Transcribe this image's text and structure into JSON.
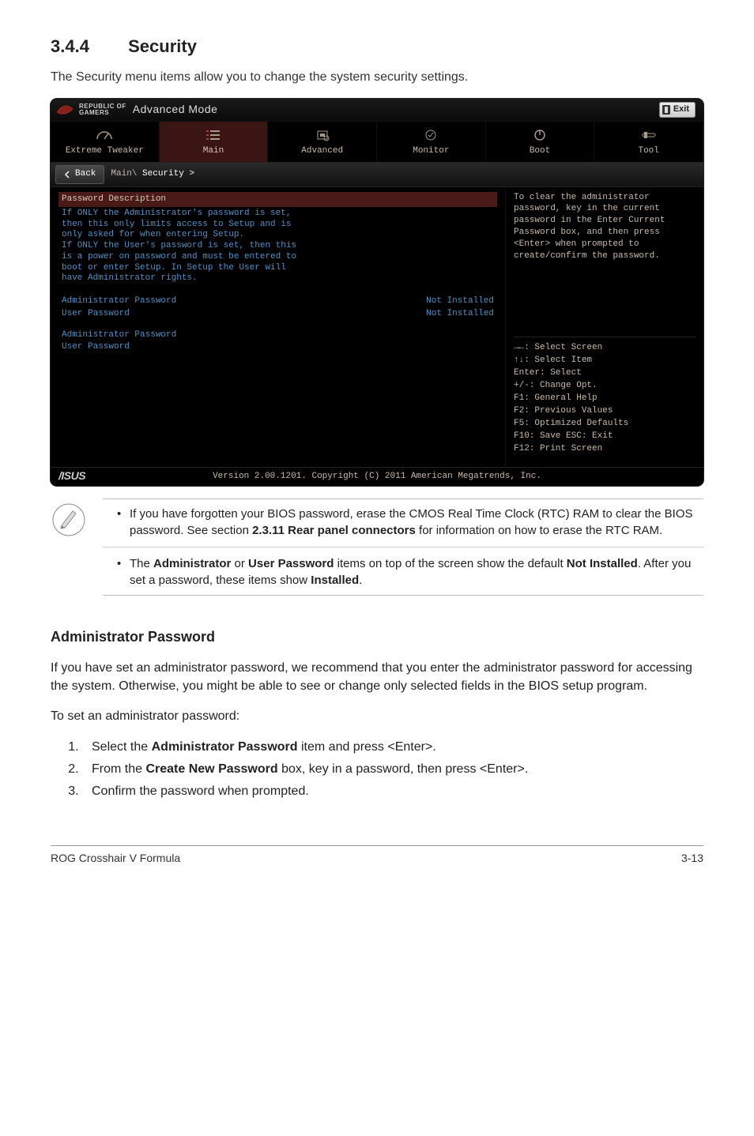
{
  "section": {
    "number": "3.4.4",
    "title": "Security"
  },
  "intro": "The Security menu items allow you to change the system security settings.",
  "bios": {
    "brand_top": "REPUBLIC OF",
    "brand_bottom": "GAMERS",
    "mode_label": "Advanced Mode",
    "exit_label": "Exit",
    "tabs": {
      "t0": "Extreme Tweaker",
      "t1": "Main",
      "t2": "Advanced",
      "t3": "Monitor",
      "t4": "Boot",
      "t5": "Tool"
    },
    "back_label": "Back",
    "breadcrumb_main": "Main\\",
    "breadcrumb_active": " Security >",
    "left": {
      "pwd_desc_label": "Password Description",
      "paragraph": "If ONLY the Administrator's password is set,\nthen this only limits access to Setup and is\nonly asked for when entering Setup.\nIf ONLY the User's password is set, then this\nis a power on password and must be entered to\nboot or enter Setup. In Setup the User will\nhave Administrator rights.",
      "admin_label": "Administrator Password",
      "admin_val": "Not Installed",
      "user_label": "User Password",
      "user_val": "Not Installed",
      "menu_admin": "Administrator Password",
      "menu_user": "User Password"
    },
    "right": {
      "help": "To clear the administrator password, key in the current password in the Enter Current Password box, and then press <Enter> when prompted to create/confirm the password.",
      "k0": "→←: Select Screen",
      "k1": "↑↓: Select Item",
      "k2": "Enter: Select",
      "k3": "+/-: Change Opt.",
      "k4": "F1: General Help",
      "k5": "F2: Previous Values",
      "k6": "F5: Optimized Defaults",
      "k7": "F10: Save  ESC: Exit",
      "k8": "F12: Print Screen"
    },
    "footer_version": "Version 2.00.1201. Copyright (C) 2011 American Megatrends, Inc.",
    "asus": "/ISUS"
  },
  "notes": {
    "n1a": "If you have forgotten your BIOS password, erase the CMOS Real Time Clock (RTC) RAM to clear the BIOS password. See section ",
    "n1b": "2.3.11 Rear panel connectors",
    "n1c": " for information on how to erase the RTC RAM.",
    "n2a": "The ",
    "n2b": "Administrator",
    "n2c": " or ",
    "n2d": "User Password",
    "n2e": " items on top of the screen show the default ",
    "n2f": "Not Installed",
    "n2g": ". After you set a password, these items show ",
    "n2h": "Installed",
    "n2i": "."
  },
  "admin_section": {
    "heading": "Administrator Password",
    "p1": "If you have set an administrator password, we recommend that you enter the administrator password for accessing the system. Otherwise, you might be able to see or change only selected fields in the BIOS setup program.",
    "p2": "To set an administrator password:",
    "s1a": "Select the ",
    "s1b": "Administrator Password",
    "s1c": " item and press <Enter>.",
    "s2a": "From the ",
    "s2b": "Create New Password",
    "s2c": " box, key in a password, then press <Enter>.",
    "s3": "Confirm the password when prompted."
  },
  "footer": {
    "left": "ROG Crosshair V Formula",
    "right": "3-13"
  }
}
